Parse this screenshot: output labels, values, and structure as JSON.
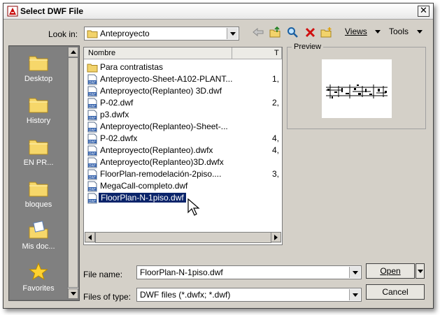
{
  "window": {
    "title": "Select DWF File"
  },
  "toolbar": {
    "look_in_label": "Look in:",
    "look_in_value": "Anteproyecto",
    "views_label": "Views",
    "tools_label": "Tools"
  },
  "places": [
    {
      "label": "Desktop"
    },
    {
      "label": "History"
    },
    {
      "label": "EN PR..."
    },
    {
      "label": "bloques"
    },
    {
      "label": "Mis doc..."
    },
    {
      "label": "Favorites"
    }
  ],
  "list": {
    "columns": [
      "Nombre",
      "T"
    ],
    "rows": [
      {
        "name": "Para contratistas",
        "size": "",
        "kind": "folder"
      },
      {
        "name": "Anteproyecto-Sheet-A102-PLANT...",
        "size": "1,",
        "kind": "dwf"
      },
      {
        "name": "Anteproyecto(Replanteo) 3D.dwf",
        "size": "",
        "kind": "dwf"
      },
      {
        "name": "P-02.dwf",
        "size": "2,",
        "kind": "dwf"
      },
      {
        "name": "p3.dwfx",
        "size": "",
        "kind": "dwf"
      },
      {
        "name": "Anteproyecto(Replanteo)-Sheet-...",
        "size": "",
        "kind": "dwf"
      },
      {
        "name": "P-02.dwfx",
        "size": "4,",
        "kind": "dwf"
      },
      {
        "name": "Anteproyecto(Replanteo).dwfx",
        "size": "4,",
        "kind": "dwf"
      },
      {
        "name": "Anteproyecto(Replanteo)3D.dwfx",
        "size": "",
        "kind": "dwf"
      },
      {
        "name": "FloorPlan-remodelación-2piso....",
        "size": "3,",
        "kind": "dwf"
      },
      {
        "name": "MegaCall-completo.dwf",
        "size": "",
        "kind": "dwf"
      },
      {
        "name": "FloorPlan-N-1piso.dwf",
        "size": "",
        "kind": "dwf",
        "selected": true
      }
    ]
  },
  "preview": {
    "label": "Preview"
  },
  "form": {
    "file_name_label": "File name:",
    "file_name_value": "FloorPlan-N-1piso.dwf",
    "file_type_label": "Files of type:",
    "file_type_value": "DWF files (*.dwfx; *.dwf)",
    "open_label": "Open",
    "cancel_label": "Cancel"
  },
  "colors": {
    "selection": "#0a246a",
    "sidebar": "#808080",
    "dialog": "#d4d0c8"
  }
}
